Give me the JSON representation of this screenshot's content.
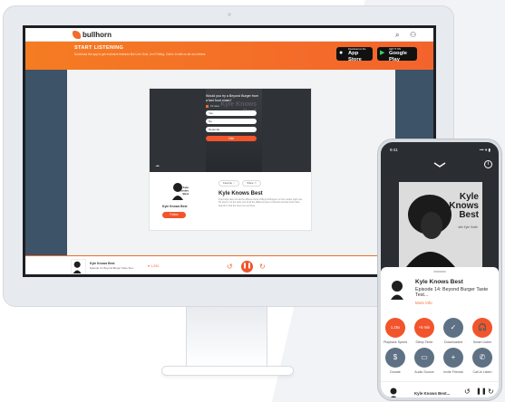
{
  "web": {
    "brand": "bullhorn",
    "promo": {
      "title": "START LISTENING",
      "subtitle": "Download the app to get exclusive features like Live Chat, Live Polling, Call-In to talk on air and others."
    },
    "stores": {
      "apple_small": "Download on the",
      "apple_big": "App Store",
      "google_small": "GET IT ON",
      "google_big": "Google Play"
    },
    "poll": {
      "question": "Would you try a Beyond Burger from a fast food chain?",
      "votes": "19 votes",
      "options": [
        "Yes",
        "No",
        "Depends"
      ],
      "vote_label": "Vote"
    },
    "video_bg_text": "Kyle Knows Best",
    "show_name": "Kyle Knows Best",
    "follow_label": "Follow",
    "pills": [
      "Favorite",
      "Share"
    ],
    "episode_title": "Kyle Knows Best",
    "episode_desc": "Kyle helps dive into all the different kind of Beyond Burgers on the market right now. He dives in to the taste test of all the different types of brands and fast food chain brands to find the best one out there.",
    "player": {
      "show": "Kyle Knows Best",
      "episode": "Episode 14: Beyond Burger Taste Test...",
      "likes": "♥ 1,293",
      "rewind": "↺",
      "forward": "↻",
      "play": "❚❚"
    }
  },
  "phone": {
    "time": "9:41",
    "signal": "••• ▾ ▮",
    "cover": {
      "title": "Kyle Knows Best",
      "with": "with Kyle Smith"
    },
    "show": "Kyle Knows Best",
    "episode": "Episode 14: Beyond Burger Taste Test...",
    "more": "More Info",
    "buttons": [
      {
        "label": "Playback Speed",
        "text": "1.25x",
        "color": "#f2542c"
      },
      {
        "label": "Sleep Timer",
        "text": "+5 min",
        "color": "#f2542c"
      },
      {
        "label": "Downloaded",
        "text": "✓",
        "color": "#5f7184"
      },
      {
        "label": "Smart Listen",
        "text": "🎧",
        "color": "#f2542c"
      },
      {
        "label": "Donate",
        "text": "$",
        "color": "#5f7184"
      },
      {
        "label": "Audio Source",
        "text": "▭",
        "color": "#5f7184"
      },
      {
        "label": "Invite Friends",
        "text": "+",
        "color": "#5f7184"
      },
      {
        "label": "Call-In Listen",
        "text": "✆",
        "color": "#5f7184"
      }
    ],
    "mini_title": "Kyle Knows Best...",
    "mini_rewind": "↺",
    "mini_pause": "❚❚",
    "mini_forward": "↻"
  },
  "colors": {
    "accent": "#f2542c",
    "screen_bg": "#3d5367",
    "button_gray": "#5f7184"
  }
}
